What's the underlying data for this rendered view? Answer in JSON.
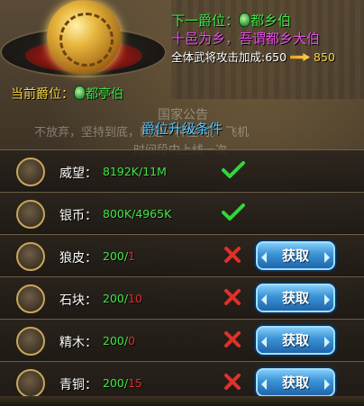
{
  "header": {
    "next_rank_label": "下一爵位：",
    "next_rank_value": "都乡伯",
    "description": "十邑为乡，吾谓都乡大伯",
    "attack_label": "全体武将攻击加成:",
    "attack_from": "650",
    "attack_to": "850",
    "current_rank_label": "当前爵位：",
    "current_rank_value": "都亭伯"
  },
  "bulletin": {
    "title": "国家公告",
    "line1": "不放弃，坚持到底，就是一种胜利。 飞机",
    "line2": "时间段内上线一次"
  },
  "panel": {
    "title": "爵位升级条件"
  },
  "requirements": [
    {
      "name": "威望",
      "have": "8192K",
      "need": "11M",
      "status": "ok",
      "icon": "jade-icon"
    },
    {
      "name": "银币",
      "have": "800K",
      "need": "4965K",
      "status": "ok",
      "icon": "silver-coin-icon"
    },
    {
      "name": "狼皮",
      "have": "200",
      "need": "1",
      "status": "fail",
      "icon": "wolf-pelt-icon",
      "button": "获取"
    },
    {
      "name": "石块",
      "have": "200",
      "need": "10",
      "status": "fail",
      "icon": "stone-icon",
      "button": "获取"
    },
    {
      "name": "精木",
      "have": "200",
      "need": "0",
      "status": "fail",
      "icon": "wood-icon",
      "button": "获取"
    },
    {
      "name": "青铜",
      "have": "200",
      "need": "15",
      "status": "fail",
      "icon": "bronze-icon",
      "button": "获取"
    }
  ],
  "colors": {
    "green": "#3ee845",
    "magenta": "#e84fe8",
    "gold": "#f5d64a",
    "red": "#e22b2b",
    "blue_title": "#4fc6ff"
  }
}
